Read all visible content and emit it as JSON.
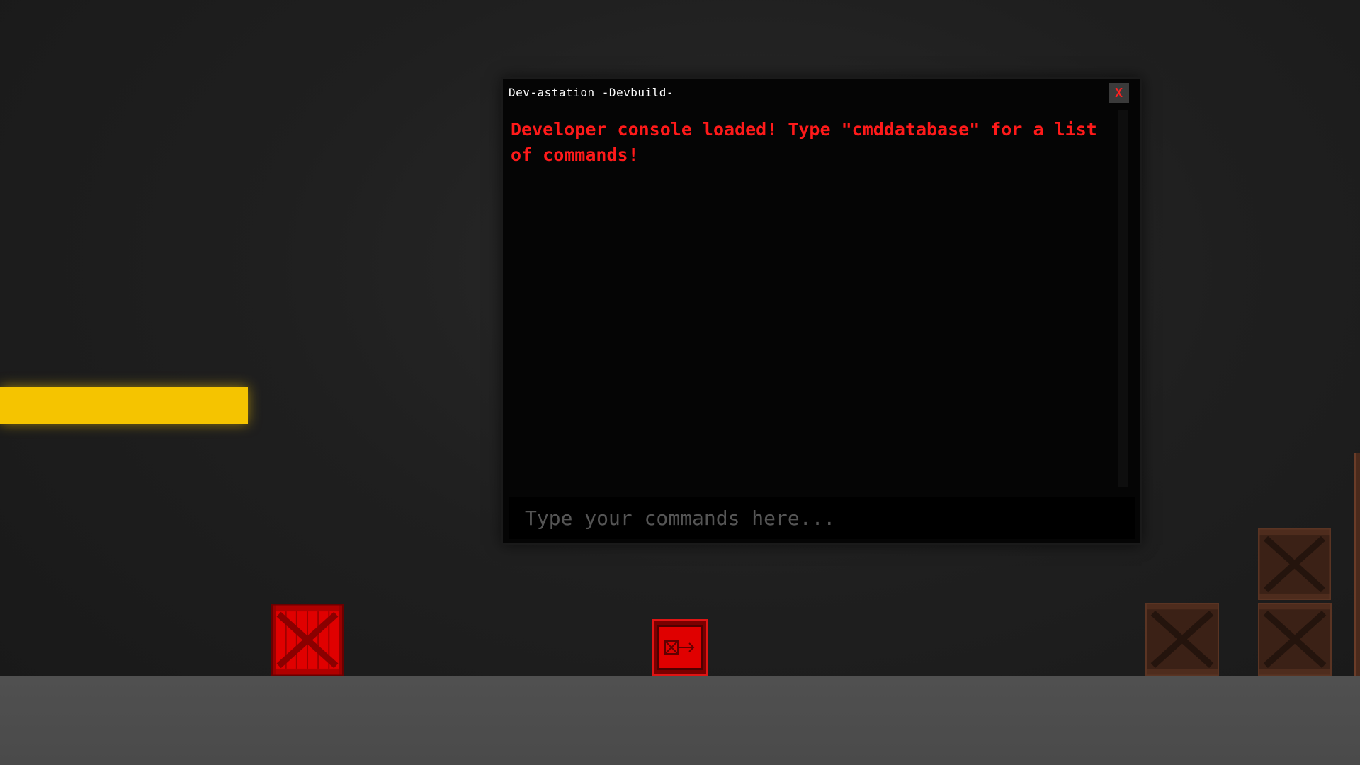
{
  "console": {
    "title": "Dev-astation -Devbuild-",
    "close_label": "X",
    "output_lines": [
      "Developer console loaded! Type \"cmddatabase\" for a list of commands!"
    ],
    "input_value": "",
    "input_placeholder": "Type your commands here..."
  },
  "colors": {
    "console_text": "#ff1a1a",
    "close_icon": "#ff2020",
    "yellow_beam": "#f5c400",
    "red_crate": "#e00000",
    "brown_crate": "#3b2116",
    "floor": "#505050",
    "background": "#1f1f1f"
  },
  "scene": {
    "objects": [
      "yellow-beam",
      "red-crate",
      "red-switch-box",
      "brown-crate",
      "brown-crate",
      "brown-crate"
    ]
  }
}
